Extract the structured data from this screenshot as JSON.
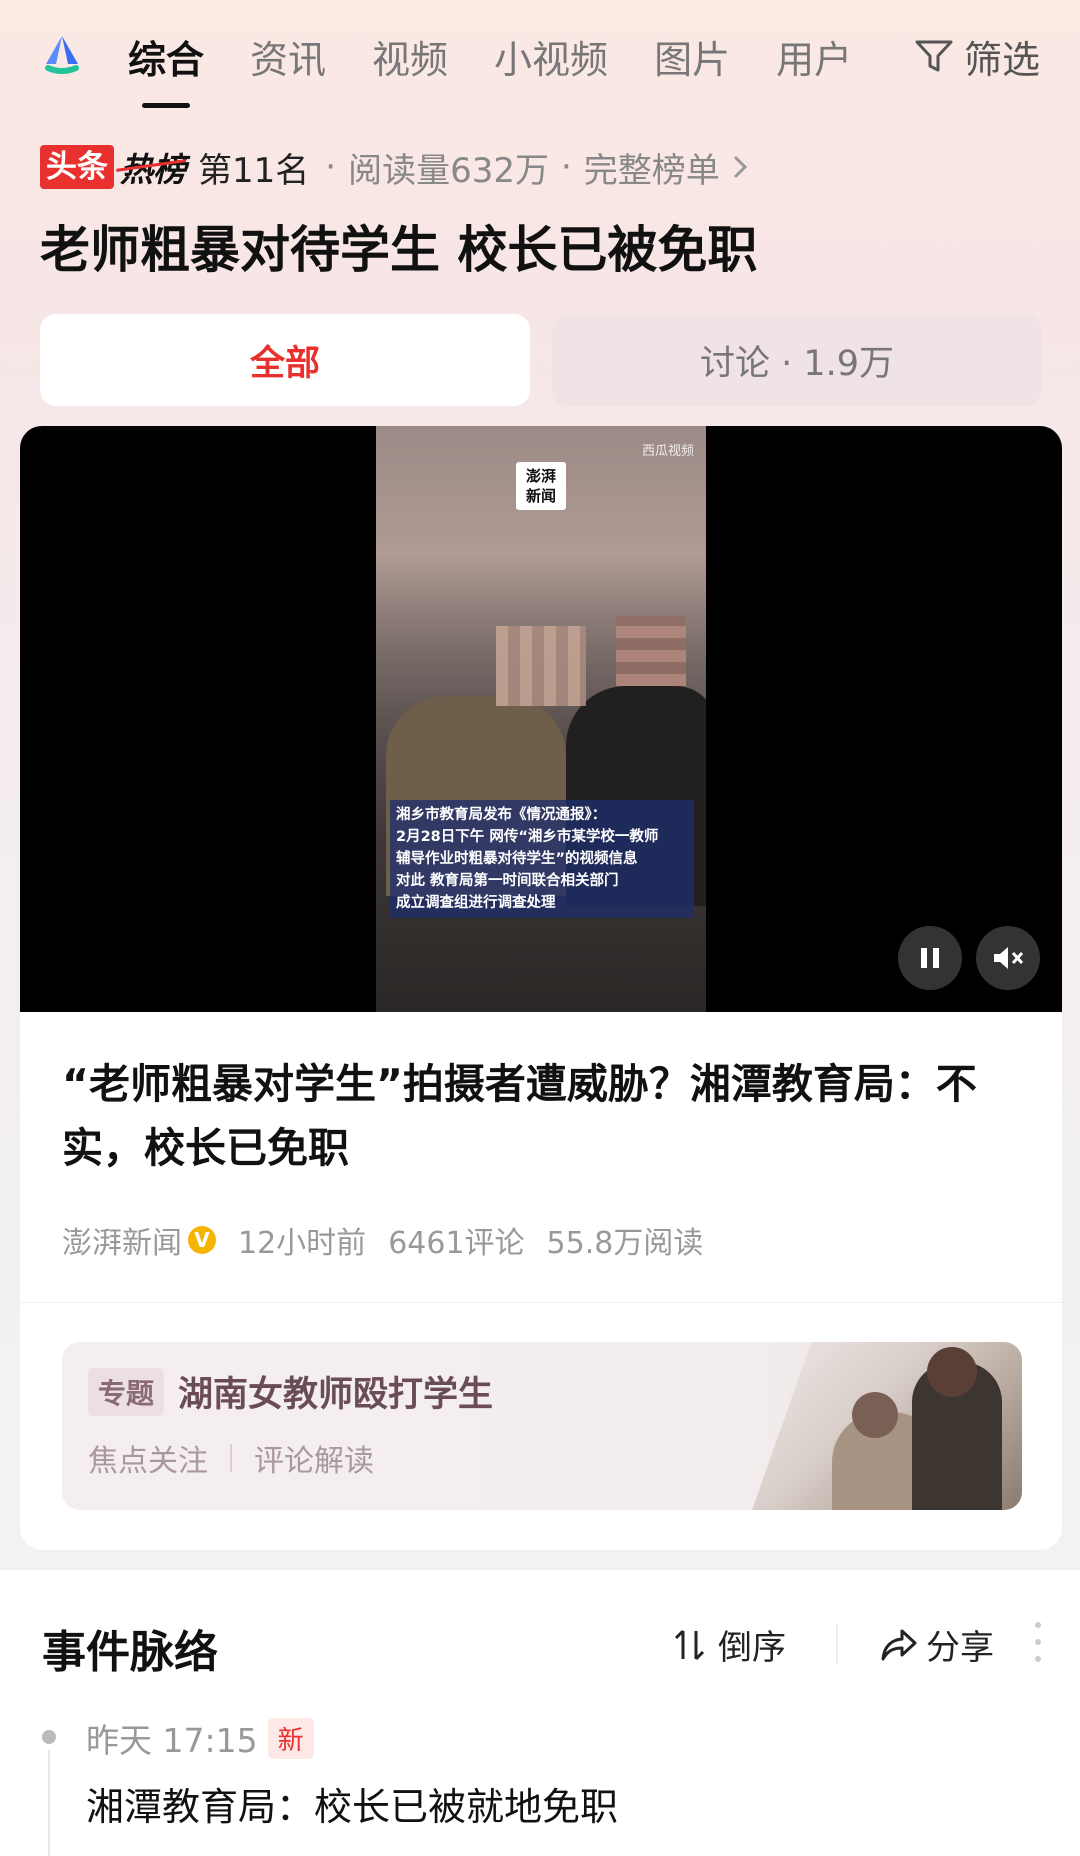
{
  "tabs": [
    "综合",
    "资讯",
    "视频",
    "小视频",
    "图片",
    "用户"
  ],
  "filter_label": "筛选",
  "rank": {
    "badge_toutiao": "头条",
    "badge_hot": "热榜",
    "position": "第11名",
    "reads": "阅读量632万",
    "full_list": "完整榜单"
  },
  "headline": "老师粗暴对待学生 校长已被免职",
  "segments": {
    "all": "全部",
    "discussion": "讨论 · 1.9万"
  },
  "video": {
    "logo": "澎湃\n新闻",
    "watermark": "西瓜视频",
    "caption": "湘乡市教育局发布《情况通报》：\n2月28日下午 网传“湘乡市某学校一教师\n辅导作业时粗暴对待学生”的视频信息\n对此 教育局第一时间联合相关部门\n成立调查组进行调查处理"
  },
  "article": {
    "title": "“老师粗暴对学生”拍摄者遭威胁？湘潭教育局：不实，校长已免职",
    "source": "澎湃新闻",
    "verified": "V",
    "time": "12小时前",
    "comments": "6461评论",
    "reads": "55.8万阅读"
  },
  "topic": {
    "tag": "专题",
    "title": "湖南女教师殴打学生",
    "link1": "焦点关注",
    "link2": "评论解读"
  },
  "timeline": {
    "title": "事件脉络",
    "sort_label": "倒序",
    "share_label": "分享",
    "items": [
      {
        "time": "昨天 17:15",
        "badge": "新",
        "text": "湘潭教育局：校长已被就地免职"
      }
    ]
  },
  "colors": {
    "accent": "#e8312e",
    "topic_text": "#6a4c58"
  }
}
